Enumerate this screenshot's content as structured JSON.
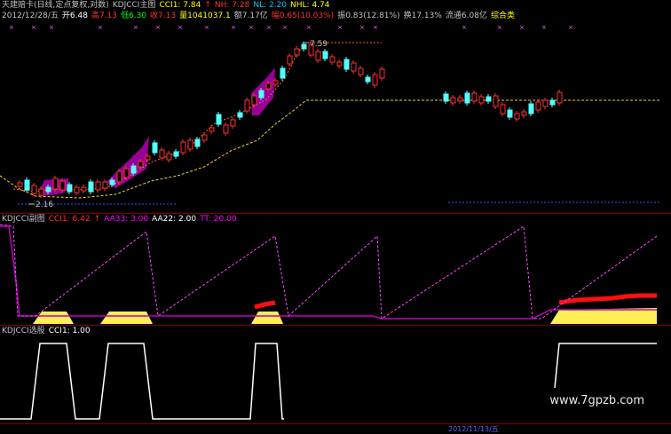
{
  "main": {
    "title_line": [
      {
        "t": "天建赔卡(日线,定点复权,对数)",
        "c": "#c0c0c0"
      },
      {
        "t": "KDJCCI主图",
        "c": "#c0c0c0"
      },
      {
        "t": "CCI1: 7.84",
        "c": "#ffff00"
      },
      {
        "t": "↑",
        "c": "#ff3030"
      },
      {
        "t": "NH: 7.28",
        "c": "#ff3030"
      },
      {
        "t": "NL: 2.20",
        "c": "#00c8ff"
      },
      {
        "t": "NHL: 4.74",
        "c": "#ffff00"
      }
    ],
    "info_line": [
      {
        "t": "2012/12/28/五",
        "c": "#c0c0c0"
      },
      {
        "t": "开6.48",
        "c": "#ffffff"
      },
      {
        "t": "高7.13",
        "c": "#ff3030"
      },
      {
        "t": "低6.30",
        "c": "#00ff00"
      },
      {
        "t": "收7.13",
        "c": "#ff3030"
      },
      {
        "t": "量1041037.1",
        "c": "#ffff00"
      },
      {
        "t": "额7.17亿",
        "c": "#c0c0c0"
      },
      {
        "t": "幅0.65(10.03%)",
        "c": "#ff3030"
      },
      {
        "t": "振0.83(12.81%)",
        "c": "#c0c0c0"
      },
      {
        "t": "换17.13%",
        "c": "#c0c0c0"
      },
      {
        "t": "流通6.08亿",
        "c": "#c0c0c0"
      },
      {
        "t": "综合类",
        "c": "#ffff00"
      }
    ],
    "price_labels": {
      "high": "7.59",
      "low": "2.16"
    }
  },
  "sub1": {
    "title_line": [
      {
        "t": "KDJCCI副图",
        "c": "#c0c0c0"
      },
      {
        "t": "CCI1: 6.42",
        "c": "#ff3030"
      },
      {
        "t": "↑",
        "c": "#ff3030"
      },
      {
        "t": "AA33: 3.00",
        "c": "#ff00ff"
      },
      {
        "t": "AA22: 2.00",
        "c": "#ffffff"
      },
      {
        "t": "TT: 20.00",
        "c": "#ff00ff"
      }
    ]
  },
  "sub2": {
    "title_line": [
      {
        "t": "KDJCCI选股",
        "c": "#c0c0c0"
      },
      {
        "t": "CCI1: 1.00",
        "c": "#ffffff"
      }
    ]
  },
  "bottom": {
    "date_label": "2012/11/13/五"
  },
  "watermark": "www.7gpzb.com",
  "colors": {
    "up": "#ff3030",
    "down": "#54ffff",
    "ma": "#ffcc33",
    "purple": "#cc00cc",
    "yellow": "#ffee55"
  }
}
